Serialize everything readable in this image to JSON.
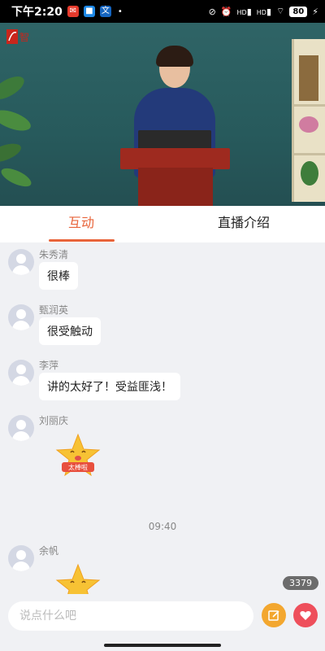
{
  "status_bar": {
    "time": "下午2:20",
    "battery": "80",
    "network_labels": [
      "HD",
      "HD"
    ]
  },
  "video": {
    "logo_text": "智"
  },
  "tabs": [
    {
      "label": "互动",
      "active": true
    },
    {
      "label": "直播介绍",
      "active": false
    }
  ],
  "chat": {
    "messages": [
      {
        "name": "朱秀清",
        "text": "很棒"
      },
      {
        "name": "甄润英",
        "text": "很受触动"
      },
      {
        "name": "李萍",
        "text": "讲的太好了！受益匪浅！"
      },
      {
        "name": "刘丽庆",
        "sticker": "太棒啦"
      },
      {
        "name": "余帆",
        "sticker": ""
      }
    ],
    "time_separator": "09:40"
  },
  "viewer_count": "3379",
  "input": {
    "placeholder": "说点什么吧"
  },
  "colors": {
    "accent": "#e8643a",
    "edit_button": "#f3a72f",
    "like_button": "#ee4f5b"
  }
}
